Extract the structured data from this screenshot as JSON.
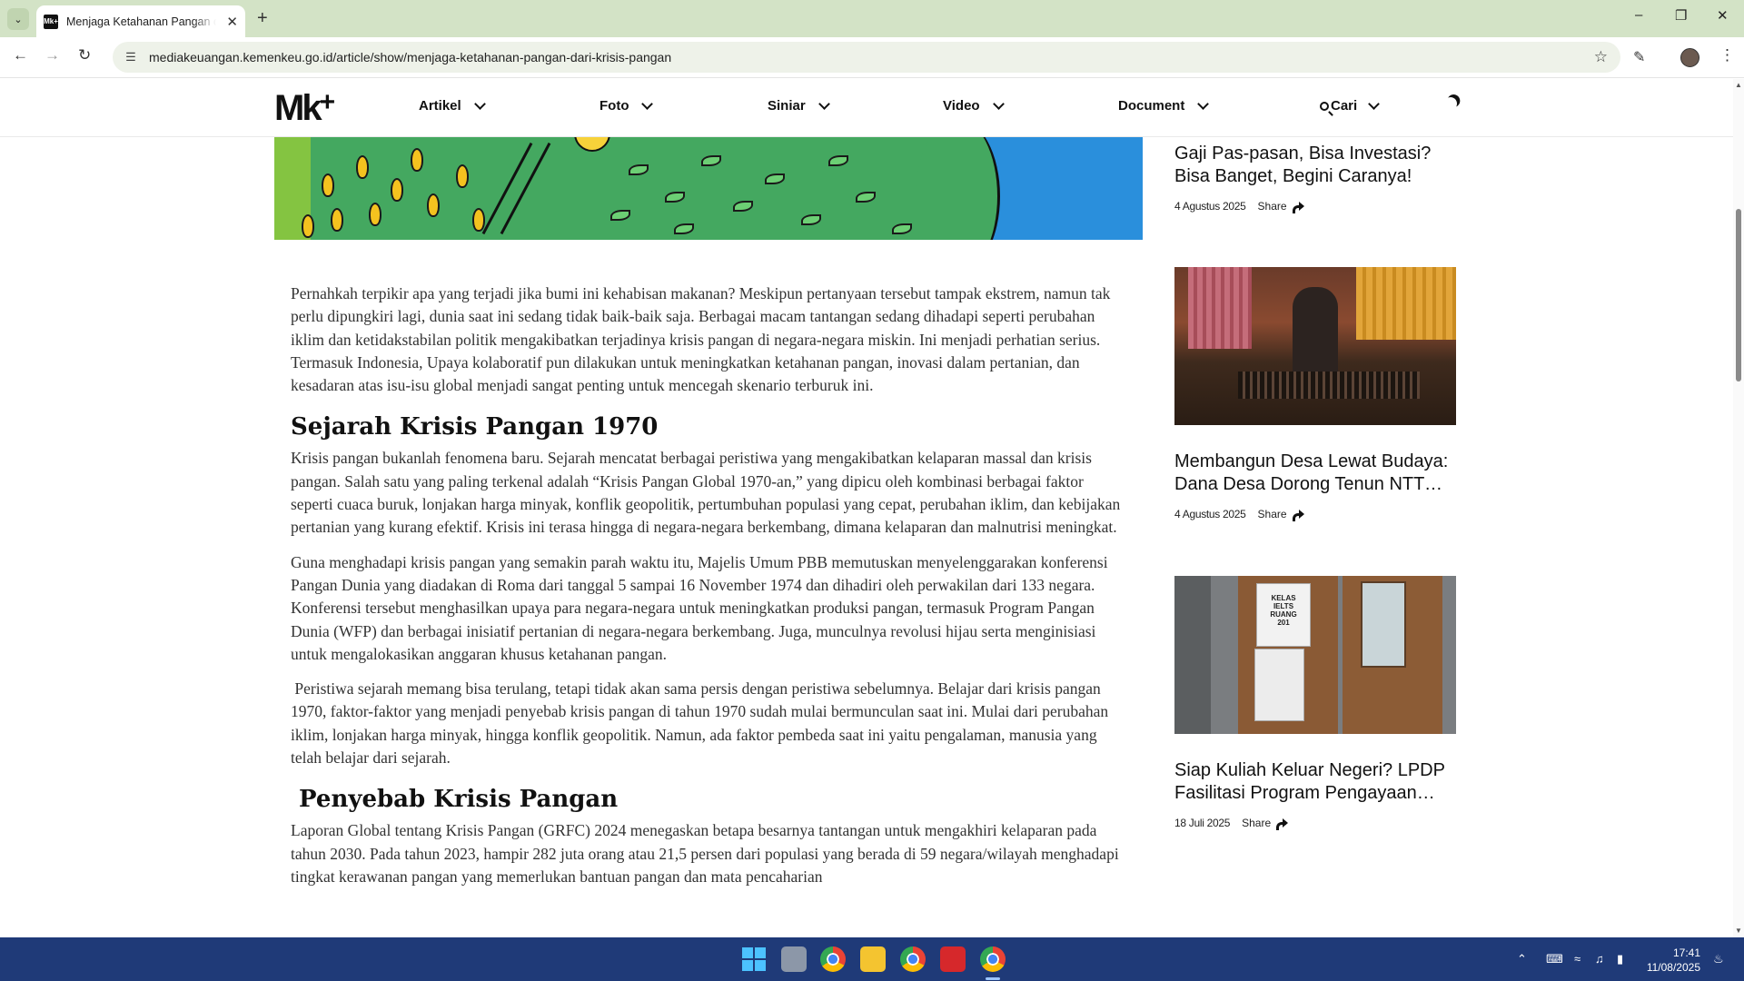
{
  "browser": {
    "tab_title": "Menjaga Ketahanan Pangan dari Krisis Pangan",
    "tab_favicon_text": "Mk+",
    "url": "mediakeuangan.kemenkeu.go.id/article/show/menjaga-ketahanan-pangan-dari-krisis-pangan"
  },
  "site": {
    "logo": "Mk",
    "logo_plus": "+",
    "nav": [
      {
        "label": "Artikel"
      },
      {
        "label": "Foto"
      },
      {
        "label": "Siniar"
      },
      {
        "label": "Video"
      },
      {
        "label": "Document"
      },
      {
        "label": "Cari"
      }
    ]
  },
  "article": {
    "intro": "Pernahkah terpikir apa yang terjadi jika bumi ini kehabisan makanan? Meskipun pertanyaan tersebut tampak ekstrem, namun tak perlu dipungkiri lagi, dunia saat ini sedang tidak baik-baik saja. Berbagai macam tantangan sedang dihadapi seperti perubahan iklim dan ketidakstabilan politik mengakibatkan terjadinya krisis pangan di negara-negara miskin. Ini  menjadi perhatian serius. Termasuk Indonesia, Upaya kolaboratif pun dilakukan untuk meningkatkan ketahanan pangan, inovasi dalam pertanian, dan kesadaran atas isu-isu global menjadi sangat penting untuk mencegah skenario terburuk ini.",
    "heading1": "Sejarah Krisis Pangan 1970",
    "p1": "Krisis pangan bukanlah fenomena baru. Sejarah mencatat berbagai peristiwa yang mengakibatkan kelaparan massal dan krisis pangan. Salah satu yang paling terkenal adalah “Krisis Pangan Global 1970-an,” yang dipicu oleh kombinasi berbagai faktor seperti cuaca buruk, lonjakan harga minyak, konflik geopolitik, pertumbuhan populasi yang cepat, perubahan iklim, dan kebijakan pertanian yang kurang efektif. Krisis ini terasa hingga di negara-negara berkembang, dimana kelaparan dan malnutrisi meningkat.",
    "p2": "Guna menghadapi krisis pangan yang semakin parah waktu itu, Majelis Umum PBB memutuskan menyelenggarakan konferensi Pangan Dunia yang diadakan di Roma dari tanggal 5 sampai 16 November 1974 dan dihadiri oleh perwakilan dari 133 negara. Konferensi tersebut menghasilkan upaya para negara-negara untuk meningkatkan produksi pangan, termasuk Program Pangan Dunia (WFP) dan berbagai inisiatif pertanian di negara-negara berkembang. Juga, munculnya revolusi hijau serta menginisiasi untuk mengalokasikan anggaran khusus ketahanan pangan.",
    "p3": " Peristiwa sejarah memang bisa terulang, tetapi tidak akan sama persis dengan peristiwa sebelumnya. Belajar dari krisis pangan 1970, faktor-faktor yang menjadi penyebab krisis pangan di tahun 1970 sudah mulai bermunculan saat ini. Mulai dari perubahan iklim, lonjakan harga minyak, hingga konflik geopolitik. Namun, ada faktor pembeda saat ini yaitu pengalaman, manusia yang telah belajar dari sejarah.",
    "heading2": " Penyebab Krisis Pangan",
    "p4": "Laporan Global tentang Krisis Pangan (GRFC) 2024 menegaskan betapa besarnya tantangan untuk mengakhiri kelaparan pada tahun 2030. Pada tahun 2023, hampir 282 juta orang atau 21,5 persen dari populasi yang berada di 59 negara/wilayah menghadapi tingkat kerawanan pangan yang memerlukan bantuan pangan dan mata pencaharian"
  },
  "sidebar": {
    "cards": [
      {
        "title": "Gaji Pas-pasan, Bisa Investasi? Bisa Banget, Begini Caranya!",
        "date": "4 Agustus 2025",
        "share": "Share"
      },
      {
        "title": "Membangun Desa Lewat Budaya: Dana Desa Dorong Tenun NTT Mendunia",
        "date": "4 Agustus 2025",
        "share": "Share"
      },
      {
        "title": "Siap Kuliah Keluar Negeri? LPDP Fasilitasi Program Pengayaan Bahasa",
        "date": "18 Juli 2025",
        "share": "Share"
      }
    ],
    "poster_text": "KELAS IELTS RUANG 201"
  },
  "taskbar": {
    "time": "17:41",
    "date": "11/08/2025"
  },
  "colors": {
    "tabbar": "#d3e3c6",
    "taskbar": "#1f3a78",
    "hero_green": "#44a860",
    "hero_blue": "#2a8fdc"
  }
}
